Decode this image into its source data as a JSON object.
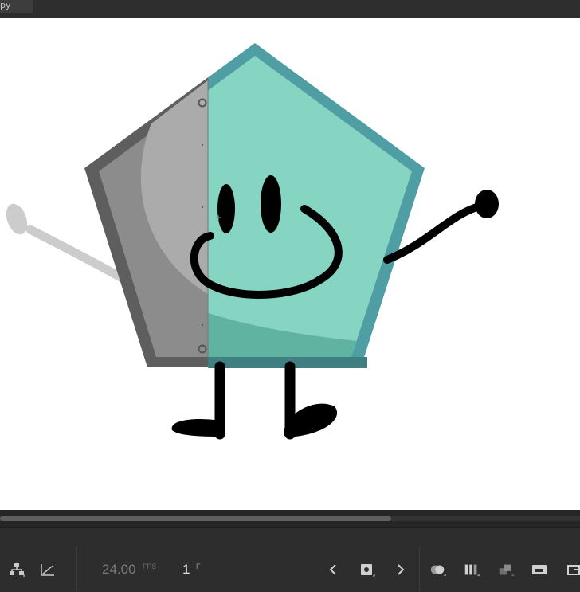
{
  "window": {
    "tab_title": "py"
  },
  "timeline": {
    "fps_value": "24.00",
    "fps_unit": "FPS",
    "frame_value": "1",
    "frame_unit": "F",
    "scroll_position": 0.67
  },
  "colors": {
    "stage_bg": "#ffffff",
    "panel_bg": "#2d2d2d",
    "pentagon_teal": "#86d4c2",
    "pentagon_teal_shadow": "#5fb3a0",
    "pentagon_border": "#4f9ea3",
    "pentagon_gray": "#8c8c8c",
    "pentagon_gray_light": "#ababab",
    "pentagon_gray_border": "#5a5a5a",
    "ink": "#000000"
  },
  "icons": {
    "left_group": [
      "hierarchy-icon",
      "graph-curve-icon"
    ],
    "right_group": [
      "prev-keyframe-icon",
      "insert-keyframe-icon",
      "next-keyframe-icon",
      "onion-skin-icon",
      "edit-multiple-frames-icon",
      "loop-icon",
      "center-frame-icon",
      "more-icon"
    ]
  }
}
